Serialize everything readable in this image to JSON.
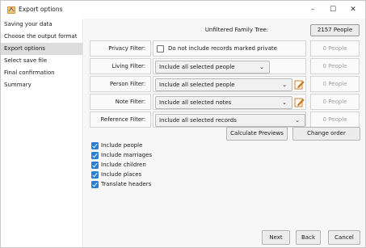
{
  "window": {
    "title": "Export options",
    "min": "–",
    "max": "☐",
    "close": "✕"
  },
  "sidebar": {
    "items": [
      {
        "label": "Saving your data"
      },
      {
        "label": "Choose the output format"
      },
      {
        "label": "Export options",
        "active": true
      },
      {
        "label": "Select save file"
      },
      {
        "label": "Final confirmation"
      },
      {
        "label": "Summary"
      }
    ]
  },
  "tree": {
    "label": "Unfiltered Family Tree:",
    "count_button": "2157 People"
  },
  "filters": {
    "privacy": {
      "label": "Privacy Filter:",
      "checkbox_label": "Do not include records marked private",
      "checked": false,
      "count": "0 People"
    },
    "living": {
      "label": "Living Filter:",
      "value": "Include all selected people",
      "count": "0 People"
    },
    "person": {
      "label": "Person Filter:",
      "value": "Include all selected people",
      "count": "0 People"
    },
    "note": {
      "label": "Note Filter:",
      "value": "Include all selected notes",
      "count": "0 People"
    },
    "reference": {
      "label": "Reference Filter:",
      "value": "Include all selected records",
      "count": "0 People"
    }
  },
  "actions": {
    "calculate": "Calculate Previews",
    "change_order": "Change order"
  },
  "options": [
    {
      "label": "Include people",
      "checked": true
    },
    {
      "label": "Include marriages",
      "checked": true
    },
    {
      "label": "Include children",
      "checked": true
    },
    {
      "label": "Include places",
      "checked": true
    },
    {
      "label": "Translate headers",
      "checked": true
    }
  ],
  "footer": {
    "next": "Next",
    "back": "Back",
    "cancel": "Cancel"
  },
  "colors": {
    "accent": "#2a7fd4",
    "edit_icon": "#e07a1a"
  }
}
